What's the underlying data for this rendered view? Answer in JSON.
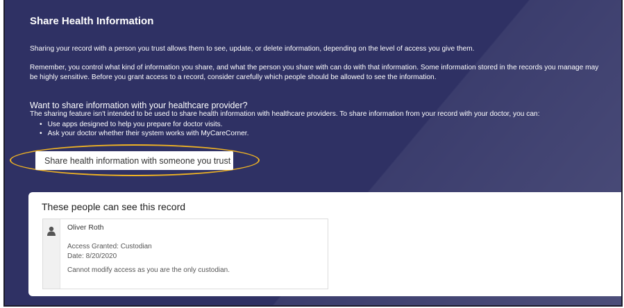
{
  "page": {
    "title": "Share Health Information",
    "intro": "Sharing your record with a person you trust allows them to see, update, or delete information, depending on the level of access you give them.",
    "reminder_line1": "Remember, you control what kind of information you share, and what the person you share with can do with that information. Some information stored in the records you manage may",
    "reminder_line2": "be highly sensitive. Before you grant access to a record, consider carefully which people should be allowed to see the information.",
    "provider_heading": "Want to share information with your healthcare provider?",
    "provider_text": "The sharing feature isn't intended to be used to share health information with healthcare providers. To share information from your record with your doctor, you can:",
    "bullets": [
      "Use apps designed to help you prepare for doctor visits.",
      "Ask your doctor whether their system works with MyCareCorner."
    ],
    "share_button_label": "Share health information with someone you trust"
  },
  "access_card": {
    "title": "These people can see this record",
    "person": {
      "name": "Oliver Roth",
      "access": "Access Granted: Custodian",
      "date": "Date: 8/20/2020",
      "note": "Cannot modify access as you are the only custodian."
    }
  },
  "colors": {
    "panel_background": "#2f3164",
    "highlight": "#f0b323",
    "text": "#ffffff"
  },
  "icons": {
    "avatar": "person-icon"
  }
}
